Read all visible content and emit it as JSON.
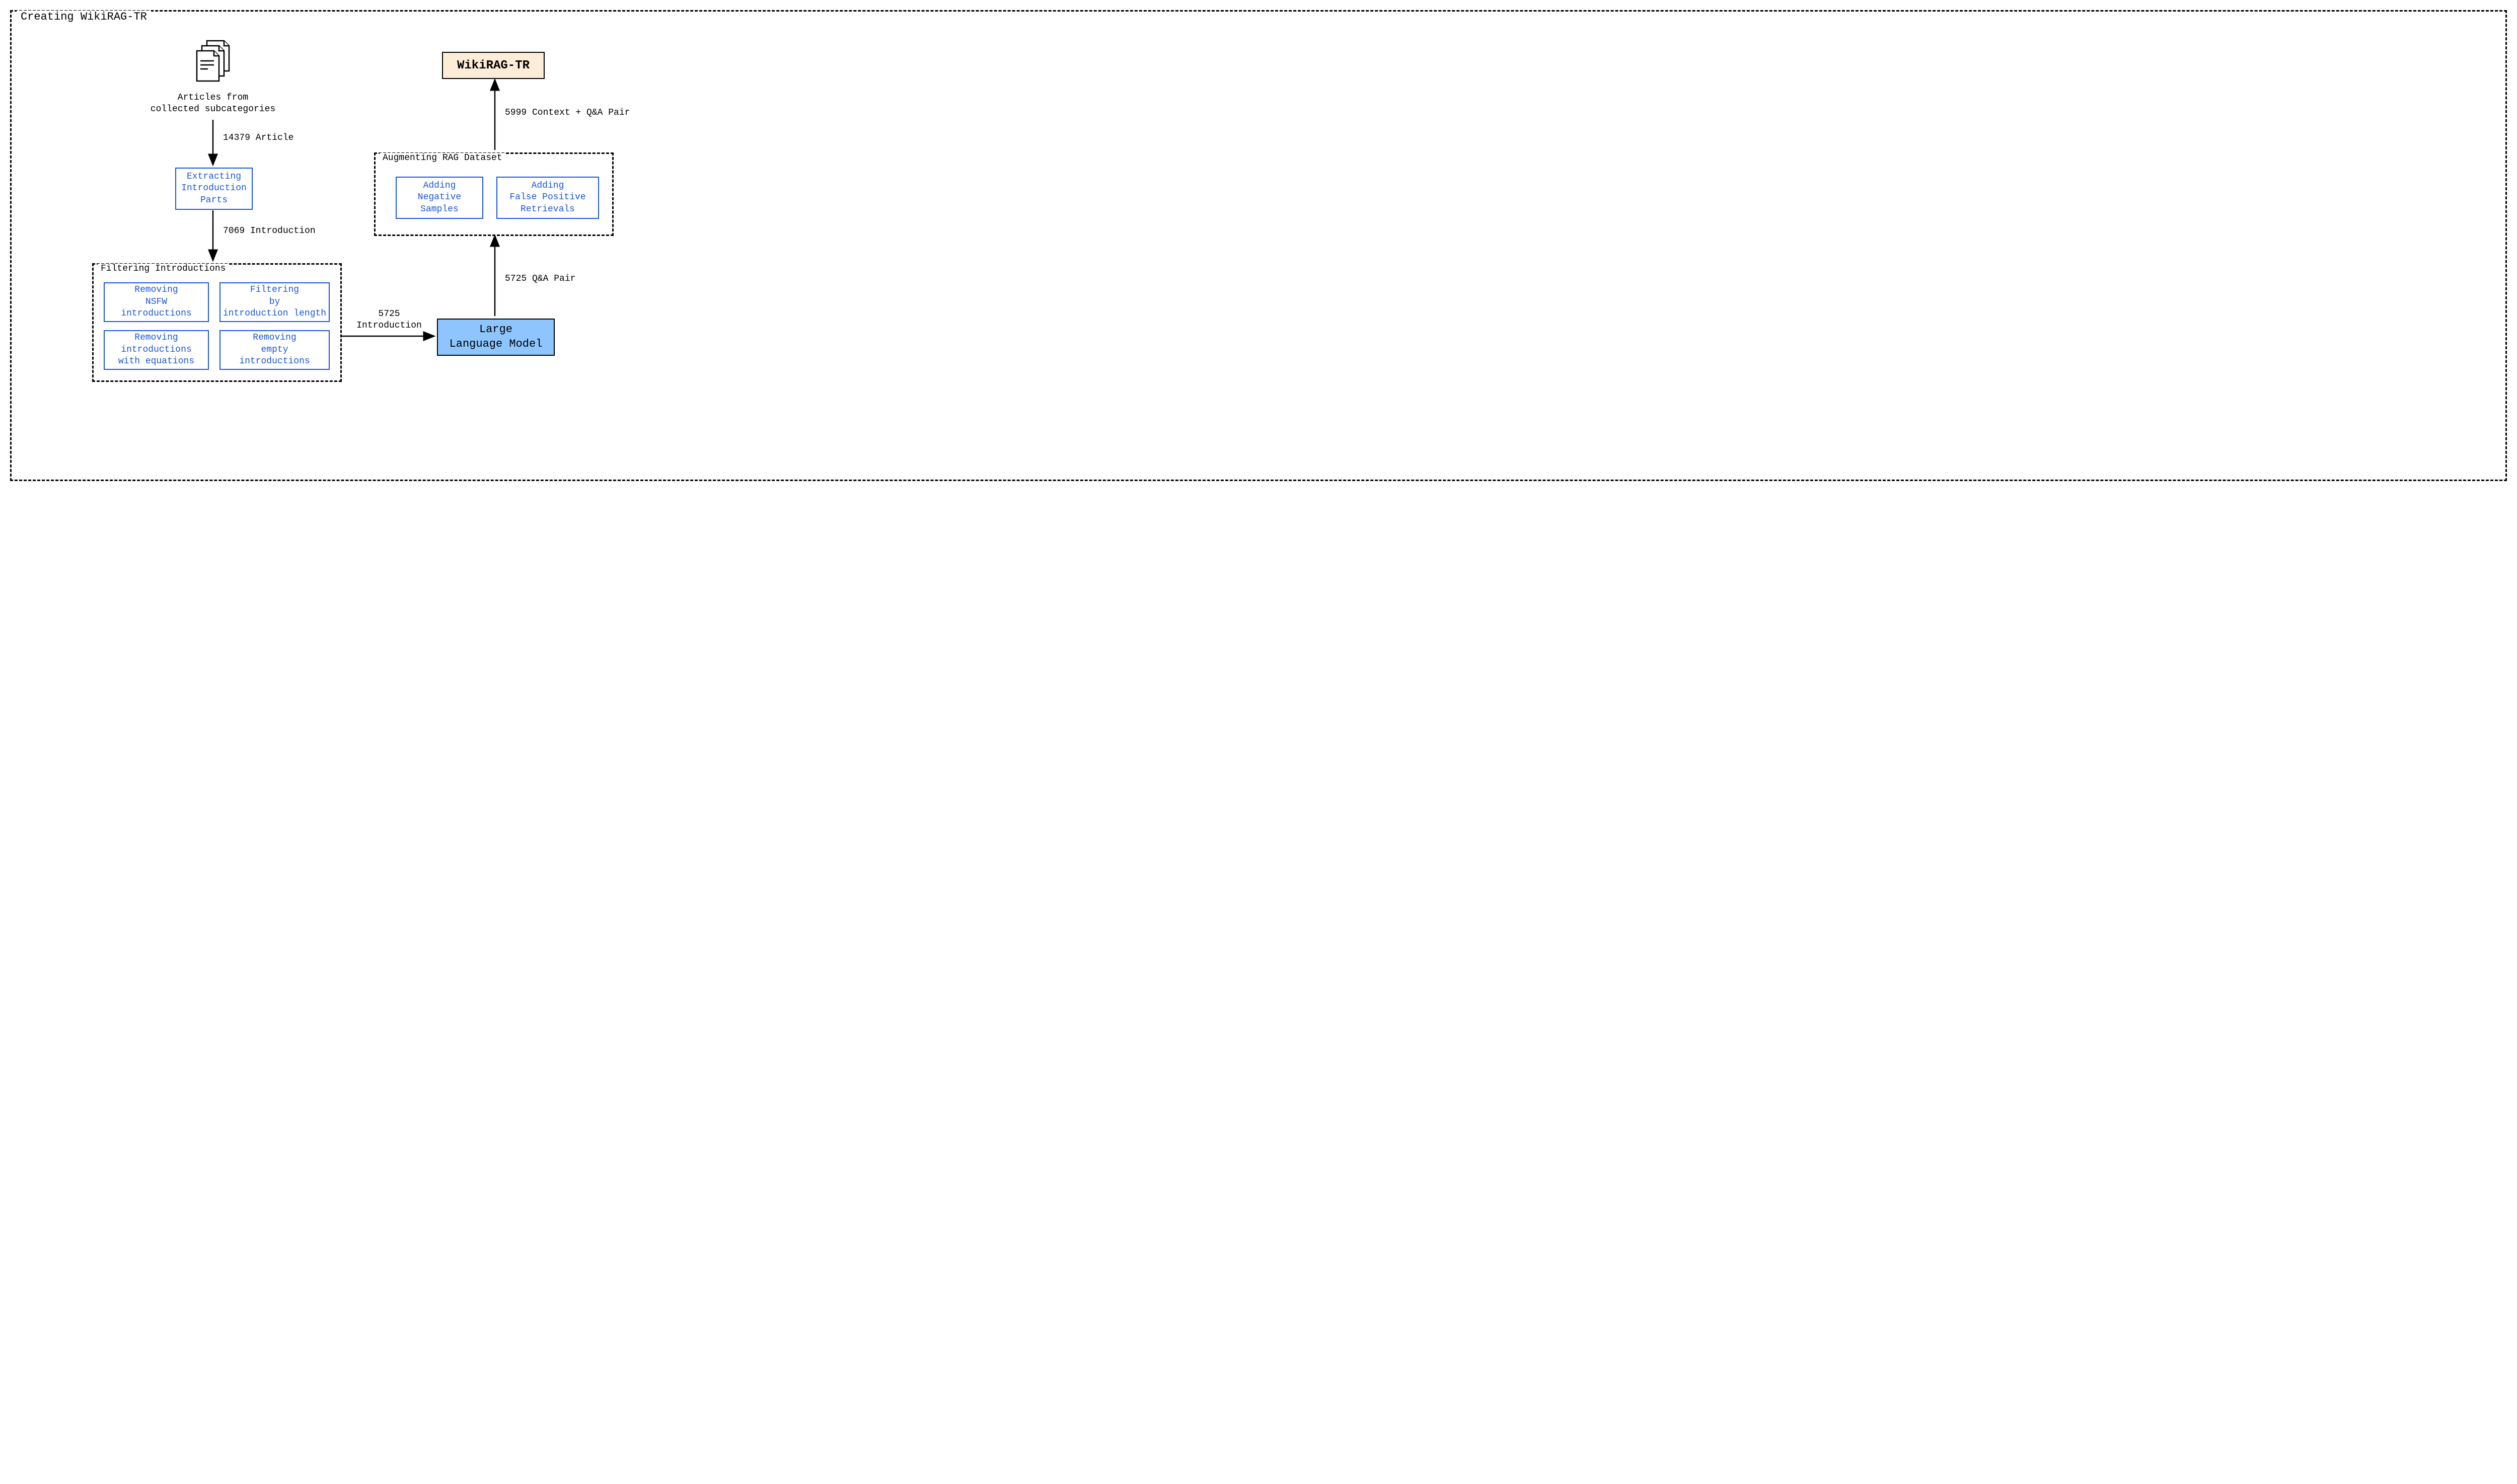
{
  "title": "Creating WikiRAG-TR",
  "articles_label": "Articles from\ncollected subcategories",
  "edge1": "14379 Article",
  "extract_box": "Extracting\nIntroduction\nParts",
  "edge2": "7069 Introduction",
  "filtering_group": "Filtering Introductions",
  "filter1": "Removing\nNSFW\nintroductions",
  "filter2": "Filtering\nby\nintroduction length",
  "filter3": "Removing\nintroductions\nwith equations",
  "filter4": "Removing\nempty\nintroductions",
  "edge3": "5725\nIntroduction",
  "llm": "Large\nLanguage Model",
  "edge4": "5725 Q&A Pair",
  "augment_group": "Augmenting RAG Dataset",
  "aug1": "Adding\nNegative\nSamples",
  "aug2": "Adding\nFalse Positive\nRetrievals",
  "edge5": "5999 Context + Q&A Pair",
  "output": "WikiRAG-TR"
}
